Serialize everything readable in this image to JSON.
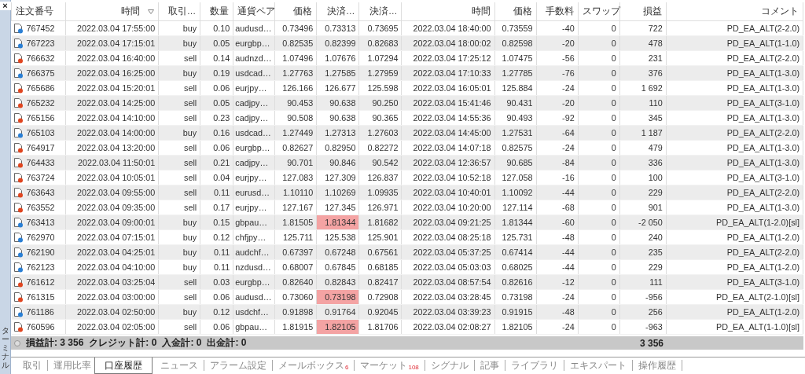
{
  "side_panel": {
    "close": "×",
    "title": "ターミナル"
  },
  "table": {
    "columns": [
      {
        "label": "注文番号",
        "sorted": false
      },
      {
        "label": "時間",
        "sorted": true
      },
      {
        "label": "取引…",
        "sorted": false
      },
      {
        "label": "数量",
        "sorted": false
      },
      {
        "label": "通貨ペア",
        "sorted": false
      },
      {
        "label": "価格",
        "sorted": false
      },
      {
        "label": "決済…",
        "sorted": false
      },
      {
        "label": "決済…",
        "sorted": false
      },
      {
        "label": "時間",
        "sorted": false
      },
      {
        "label": "価格",
        "sorted": false
      },
      {
        "label": "手数料",
        "sorted": false
      },
      {
        "label": "スワップ",
        "sorted": false
      },
      {
        "label": "損益",
        "sorted": false
      },
      {
        "label": "コメント",
        "sorted": false
      }
    ],
    "rows": [
      {
        "kind": "buy",
        "close_highlighted": false,
        "cells": [
          "767452",
          "2022.03.04 17:55:00",
          "buy",
          "0.10",
          "audusd…",
          "0.73496",
          "0.73313",
          "0.73695",
          "2022.03.04 18:40:00",
          "0.73559",
          "-40",
          "0",
          "722",
          "PD_EA_ALT(2-2.0)"
        ]
      },
      {
        "kind": "buy",
        "close_highlighted": false,
        "cells": [
          "767223",
          "2022.03.04 17:15:01",
          "buy",
          "0.05",
          "eurgbp…",
          "0.82535",
          "0.82399",
          "0.82683",
          "2022.03.04 18:00:02",
          "0.82598",
          "-20",
          "0",
          "478",
          "PD_EA_ALT(1-1.0)"
        ]
      },
      {
        "kind": "sell",
        "close_highlighted": false,
        "cells": [
          "766632",
          "2022.03.04 16:40:00",
          "sell",
          "0.14",
          "audnzd…",
          "1.07496",
          "1.07676",
          "1.07294",
          "2022.03.04 17:25:12",
          "1.07475",
          "-56",
          "0",
          "231",
          "PD_EA_ALT(2-2.0)"
        ]
      },
      {
        "kind": "buy",
        "close_highlighted": false,
        "cells": [
          "766375",
          "2022.03.04 16:25:00",
          "buy",
          "0.19",
          "usdcad…",
          "1.27763",
          "1.27585",
          "1.27959",
          "2022.03.04 17:10:33",
          "1.27785",
          "-76",
          "0",
          "376",
          "PD_EA_ALT(1-3.0)"
        ]
      },
      {
        "kind": "sell",
        "close_highlighted": false,
        "cells": [
          "765686",
          "2022.03.04 15:20:01",
          "sell",
          "0.06",
          "eurjpy…",
          "126.166",
          "126.677",
          "125.598",
          "2022.03.04 16:05:01",
          "125.884",
          "-24",
          "0",
          "1 692",
          "PD_EA_ALT(1-3.0)"
        ]
      },
      {
        "kind": "sell",
        "close_highlighted": false,
        "cells": [
          "765232",
          "2022.03.04 14:25:00",
          "sell",
          "0.05",
          "cadjpy…",
          "90.453",
          "90.638",
          "90.250",
          "2022.03.04 15:41:46",
          "90.431",
          "-20",
          "0",
          "110",
          "PD_EA_ALT(3-1.0)"
        ]
      },
      {
        "kind": "sell",
        "close_highlighted": false,
        "cells": [
          "765156",
          "2022.03.04 14:10:00",
          "sell",
          "0.23",
          "cadjpy…",
          "90.508",
          "90.638",
          "90.365",
          "2022.03.04 14:55:36",
          "90.493",
          "-92",
          "0",
          "345",
          "PD_EA_ALT(1-3.0)"
        ]
      },
      {
        "kind": "buy",
        "close_highlighted": false,
        "cells": [
          "765103",
          "2022.03.04 14:00:00",
          "buy",
          "0.16",
          "usdcad…",
          "1.27449",
          "1.27313",
          "1.27603",
          "2022.03.04 14:45:00",
          "1.27531",
          "-64",
          "0",
          "1 187",
          "PD_EA_ALT(2-2.0)"
        ]
      },
      {
        "kind": "sell",
        "close_highlighted": false,
        "cells": [
          "764917",
          "2022.03.04 13:20:00",
          "sell",
          "0.06",
          "eurgbp…",
          "0.82627",
          "0.82950",
          "0.82272",
          "2022.03.04 14:07:18",
          "0.82575",
          "-24",
          "0",
          "479",
          "PD_EA_ALT(1-3.0)"
        ]
      },
      {
        "kind": "sell",
        "close_highlighted": false,
        "cells": [
          "764433",
          "2022.03.04 11:50:01",
          "sell",
          "0.21",
          "cadjpy…",
          "90.701",
          "90.846",
          "90.542",
          "2022.03.04 12:36:57",
          "90.685",
          "-84",
          "0",
          "336",
          "PD_EA_ALT(1-3.0)"
        ]
      },
      {
        "kind": "sell",
        "close_highlighted": false,
        "cells": [
          "763724",
          "2022.03.04 10:05:01",
          "sell",
          "0.04",
          "eurjpy…",
          "127.083",
          "127.309",
          "126.837",
          "2022.03.04 10:52:18",
          "127.058",
          "-16",
          "0",
          "100",
          "PD_EA_ALT(3-1.0)"
        ]
      },
      {
        "kind": "sell",
        "close_highlighted": false,
        "cells": [
          "763643",
          "2022.03.04 09:55:00",
          "sell",
          "0.11",
          "eurusd…",
          "1.10110",
          "1.10269",
          "1.09935",
          "2022.03.04 10:40:01",
          "1.10092",
          "-44",
          "0",
          "229",
          "PD_EA_ALT(2-2.0)"
        ]
      },
      {
        "kind": "sell",
        "close_highlighted": false,
        "cells": [
          "763552",
          "2022.03.04 09:35:00",
          "sell",
          "0.17",
          "eurjpy…",
          "127.167",
          "127.345",
          "126.971",
          "2022.03.04 10:20:00",
          "127.114",
          "-68",
          "0",
          "901",
          "PD_EA_ALT(1-3.0)"
        ]
      },
      {
        "kind": "buy",
        "close_highlighted": true,
        "cells": [
          "763413",
          "2022.03.04 09:00:01",
          "buy",
          "0.15",
          "gbpau…",
          "1.81505",
          "1.81344",
          "1.81682",
          "2022.03.04 09:21:25",
          "1.81344",
          "-60",
          "0",
          "-2 050",
          "PD_EA_ALT(1-2.0)[sl]"
        ]
      },
      {
        "kind": "buy",
        "close_highlighted": false,
        "cells": [
          "762970",
          "2022.03.04 07:15:01",
          "buy",
          "0.12",
          "chfjpy…",
          "125.711",
          "125.538",
          "125.901",
          "2022.03.04 08:25:18",
          "125.731",
          "-48",
          "0",
          "240",
          "PD_EA_ALT(1-2.0)"
        ]
      },
      {
        "kind": "buy",
        "close_highlighted": false,
        "cells": [
          "762190",
          "2022.03.04 04:25:01",
          "buy",
          "0.11",
          "audchf…",
          "0.67397",
          "0.67248",
          "0.67561",
          "2022.03.04 05:37:25",
          "0.67414",
          "-44",
          "0",
          "235",
          "PD_EA_ALT(2-2.0)"
        ]
      },
      {
        "kind": "buy",
        "close_highlighted": false,
        "cells": [
          "762123",
          "2022.03.04 04:10:00",
          "buy",
          "0.11",
          "nzdusd…",
          "0.68007",
          "0.67845",
          "0.68185",
          "2022.03.04 05:03:03",
          "0.68025",
          "-44",
          "0",
          "229",
          "PD_EA_ALT(1-2.0)"
        ]
      },
      {
        "kind": "sell",
        "close_highlighted": false,
        "cells": [
          "761612",
          "2022.03.04 03:25:04",
          "sell",
          "0.03",
          "eurgbp…",
          "0.82640",
          "0.82843",
          "0.82417",
          "2022.03.04 08:57:54",
          "0.82616",
          "-12",
          "0",
          "111",
          "PD_EA_ALT(3-1.0)"
        ]
      },
      {
        "kind": "sell",
        "close_highlighted": true,
        "cells": [
          "761315",
          "2022.03.04 03:00:00",
          "sell",
          "0.06",
          "audusd…",
          "0.73060",
          "0.73198",
          "0.72908",
          "2022.03.04 03:28:45",
          "0.73198",
          "-24",
          "0",
          "-956",
          "PD_EA_ALT(2-1.0)[sl]"
        ]
      },
      {
        "kind": "buy",
        "close_highlighted": false,
        "cells": [
          "761186",
          "2022.03.04 02:50:00",
          "buy",
          "0.12",
          "usdchf…",
          "0.91898",
          "0.91764",
          "0.92045",
          "2022.03.04 03:39:23",
          "0.91915",
          "-48",
          "0",
          "256",
          "PD_EA_ALT(1-2.0)"
        ]
      },
      {
        "kind": "sell",
        "close_highlighted": true,
        "cells": [
          "760596",
          "2022.03.04 02:05:00",
          "sell",
          "0.06",
          "gbpau…",
          "1.81915",
          "1.82105",
          "1.81706",
          "2022.03.04 02:08:27",
          "1.82105",
          "-24",
          "0",
          "-963",
          "PD_EA_ALT(1-1.0)[sl]"
        ]
      }
    ],
    "summary": {
      "items": [
        "損益計: 3 356",
        "クレジット計: 0",
        "入金計: 0",
        "出金計: 0"
      ],
      "profit_total": "3 356"
    }
  },
  "tabs": [
    {
      "label": "取引",
      "selected": false
    },
    {
      "label": "運用比率",
      "selected": false
    },
    {
      "label": "口座履歴",
      "selected": true
    },
    {
      "label": "ニュース",
      "selected": false
    },
    {
      "label": "アラーム設定",
      "selected": false
    },
    {
      "label": "メールボックス",
      "badge": "6",
      "selected": false
    },
    {
      "label": "マーケット",
      "badge": "108",
      "selected": false
    },
    {
      "label": "シグナル",
      "selected": false
    },
    {
      "label": "記事",
      "selected": false
    },
    {
      "label": "ライブラリ",
      "selected": false
    },
    {
      "label": "エキスパート",
      "selected": false
    },
    {
      "label": "操作履歴",
      "selected": false
    }
  ]
}
